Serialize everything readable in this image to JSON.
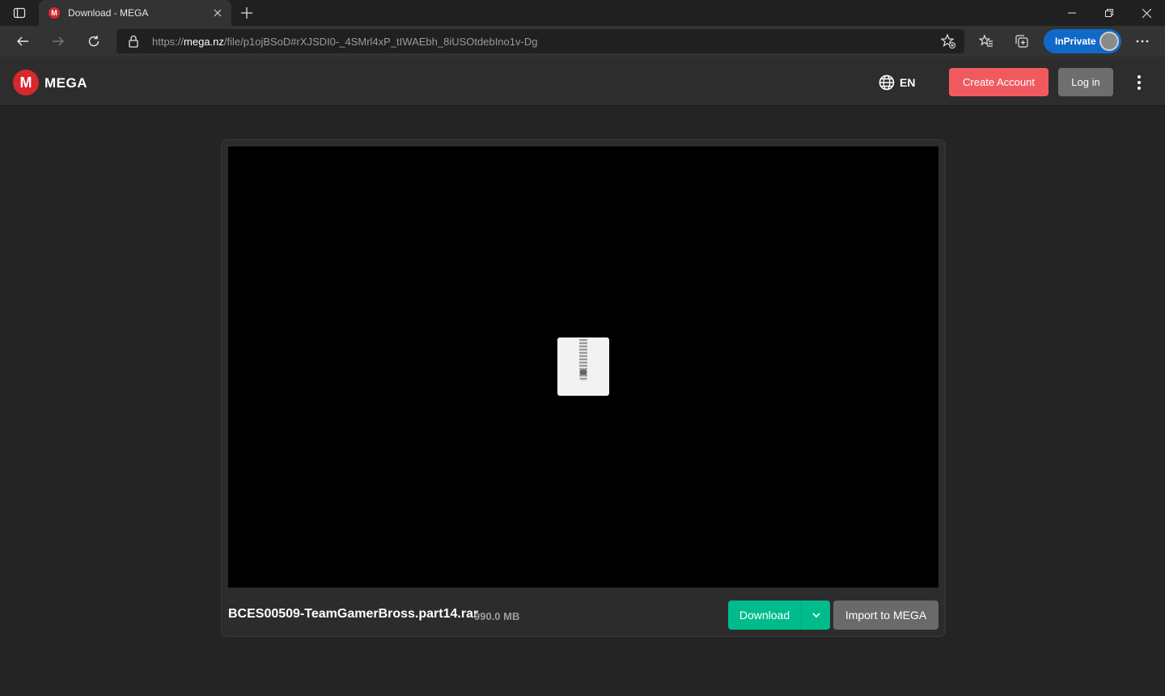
{
  "browser": {
    "tab_title": "Download - MEGA",
    "url_proto": "https://",
    "url_host": "mega.nz",
    "url_path": "/file/p1ojBSoD#rXJSDI0-_4SMrl4xP_tIWAEbh_8iUSOtdebIno1v-Dg",
    "inprivate_label": "InPrivate"
  },
  "header": {
    "brand": "MEGA",
    "logo_letter": "M",
    "language": "EN",
    "create_account": "Create Account",
    "login": "Log in"
  },
  "file": {
    "name": "BCES00509-TeamGamerBross.part14.rar",
    "size": "990.0 MB",
    "download_label": "Download",
    "import_label": "Import to MEGA"
  },
  "colors": {
    "mega_red": "#d9272e",
    "create_account_bg": "#f05a5f",
    "download_green": "#00bc8c",
    "inprivate_blue": "#1169c7"
  }
}
